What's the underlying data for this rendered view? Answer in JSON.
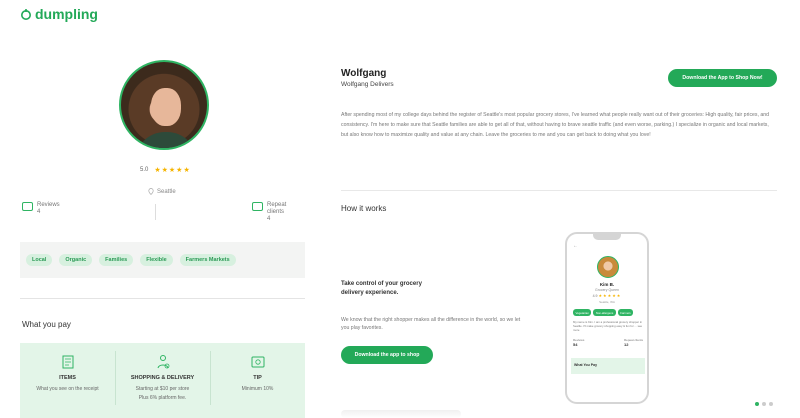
{
  "brand": {
    "name": "dumpling",
    "color": "#23a958"
  },
  "profile": {
    "rating": "5.0",
    "stars": "★★★★★",
    "location": "Seattle",
    "reviews_label": "Reviews",
    "reviews_value": "4",
    "repeat_label": "Repeat clients",
    "repeat_value": "4",
    "tags": [
      "Local",
      "Organic",
      "Families",
      "Flexible",
      "Farmers Markets"
    ]
  },
  "what_you_pay": {
    "title": "What you pay",
    "columns": [
      {
        "icon": "receipt-icon",
        "heading": "ITEMS",
        "desc": "What you see on the receipt"
      },
      {
        "icon": "delivery-icon",
        "heading": "SHOPPING & DELIVERY",
        "desc": "Starting at $10 per store",
        "desc2": "Plus 6% platform fee."
      },
      {
        "icon": "tip-icon",
        "heading": "TIP",
        "desc": "Minimum 10%"
      }
    ]
  },
  "header": {
    "name": "Wolfgang",
    "subtitle": "Wolfgang Delivers",
    "cta_top": "Download the App to Shop Now!"
  },
  "bio": "After spending most of my college days behind the register of Seattle's most popular grocery stores, I've learned what people really want out of their groceries: High quality, fair prices, and consistency. I'm here to make sure that Seattle families are able to get all of that, without having to brave seattle traffic (and even worse, parking.) I specialize in organic and local markets, but also know how to maximize quality and value at any chain. Leave the groceries to me and you can get back to doing what you love!",
  "how_it_works": {
    "title": "How it works",
    "take_control": "Take control of your grocery delivery experience.",
    "we_know": "We know that the right shopper makes all the difference in the world, so we let you play favorites.",
    "cta": "Download the app to shop"
  },
  "phone": {
    "back": "←",
    "name": "Kim B.",
    "role": "Grocery Queen",
    "rating": "4.9",
    "stars": "★★★★★",
    "location": "Seattle, WA",
    "tags": [
      "Vegetarian",
      "Non-allergens",
      "Farmers"
    ],
    "bio": "My name is Kim. I am a professional grocery shopper in Seattle. I'll make grocery shopping easy & fun for ... see more",
    "reviews_label": "Reviews",
    "reviews_value": "54",
    "repeat_label": "Repeat clients",
    "repeat_value": "12",
    "pay": "What You Pay"
  }
}
